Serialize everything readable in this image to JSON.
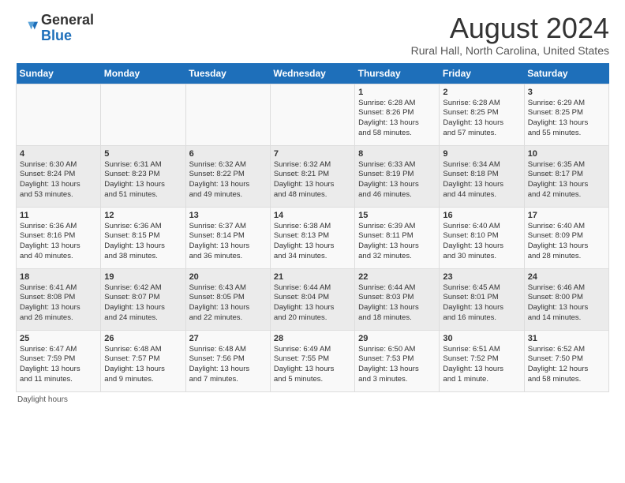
{
  "logo": {
    "general": "General",
    "blue": "Blue"
  },
  "title": "August 2024",
  "subtitle": "Rural Hall, North Carolina, United States",
  "footer": "Daylight hours",
  "headers": [
    "Sunday",
    "Monday",
    "Tuesday",
    "Wednesday",
    "Thursday",
    "Friday",
    "Saturday"
  ],
  "weeks": [
    [
      {
        "day": "",
        "info": ""
      },
      {
        "day": "",
        "info": ""
      },
      {
        "day": "",
        "info": ""
      },
      {
        "day": "",
        "info": ""
      },
      {
        "day": "1",
        "info": "Sunrise: 6:28 AM\nSunset: 8:26 PM\nDaylight: 13 hours\nand 58 minutes."
      },
      {
        "day": "2",
        "info": "Sunrise: 6:28 AM\nSunset: 8:25 PM\nDaylight: 13 hours\nand 57 minutes."
      },
      {
        "day": "3",
        "info": "Sunrise: 6:29 AM\nSunset: 8:25 PM\nDaylight: 13 hours\nand 55 minutes."
      }
    ],
    [
      {
        "day": "4",
        "info": "Sunrise: 6:30 AM\nSunset: 8:24 PM\nDaylight: 13 hours\nand 53 minutes."
      },
      {
        "day": "5",
        "info": "Sunrise: 6:31 AM\nSunset: 8:23 PM\nDaylight: 13 hours\nand 51 minutes."
      },
      {
        "day": "6",
        "info": "Sunrise: 6:32 AM\nSunset: 8:22 PM\nDaylight: 13 hours\nand 49 minutes."
      },
      {
        "day": "7",
        "info": "Sunrise: 6:32 AM\nSunset: 8:21 PM\nDaylight: 13 hours\nand 48 minutes."
      },
      {
        "day": "8",
        "info": "Sunrise: 6:33 AM\nSunset: 8:19 PM\nDaylight: 13 hours\nand 46 minutes."
      },
      {
        "day": "9",
        "info": "Sunrise: 6:34 AM\nSunset: 8:18 PM\nDaylight: 13 hours\nand 44 minutes."
      },
      {
        "day": "10",
        "info": "Sunrise: 6:35 AM\nSunset: 8:17 PM\nDaylight: 13 hours\nand 42 minutes."
      }
    ],
    [
      {
        "day": "11",
        "info": "Sunrise: 6:36 AM\nSunset: 8:16 PM\nDaylight: 13 hours\nand 40 minutes."
      },
      {
        "day": "12",
        "info": "Sunrise: 6:36 AM\nSunset: 8:15 PM\nDaylight: 13 hours\nand 38 minutes."
      },
      {
        "day": "13",
        "info": "Sunrise: 6:37 AM\nSunset: 8:14 PM\nDaylight: 13 hours\nand 36 minutes."
      },
      {
        "day": "14",
        "info": "Sunrise: 6:38 AM\nSunset: 8:13 PM\nDaylight: 13 hours\nand 34 minutes."
      },
      {
        "day": "15",
        "info": "Sunrise: 6:39 AM\nSunset: 8:11 PM\nDaylight: 13 hours\nand 32 minutes."
      },
      {
        "day": "16",
        "info": "Sunrise: 6:40 AM\nSunset: 8:10 PM\nDaylight: 13 hours\nand 30 minutes."
      },
      {
        "day": "17",
        "info": "Sunrise: 6:40 AM\nSunset: 8:09 PM\nDaylight: 13 hours\nand 28 minutes."
      }
    ],
    [
      {
        "day": "18",
        "info": "Sunrise: 6:41 AM\nSunset: 8:08 PM\nDaylight: 13 hours\nand 26 minutes."
      },
      {
        "day": "19",
        "info": "Sunrise: 6:42 AM\nSunset: 8:07 PM\nDaylight: 13 hours\nand 24 minutes."
      },
      {
        "day": "20",
        "info": "Sunrise: 6:43 AM\nSunset: 8:05 PM\nDaylight: 13 hours\nand 22 minutes."
      },
      {
        "day": "21",
        "info": "Sunrise: 6:44 AM\nSunset: 8:04 PM\nDaylight: 13 hours\nand 20 minutes."
      },
      {
        "day": "22",
        "info": "Sunrise: 6:44 AM\nSunset: 8:03 PM\nDaylight: 13 hours\nand 18 minutes."
      },
      {
        "day": "23",
        "info": "Sunrise: 6:45 AM\nSunset: 8:01 PM\nDaylight: 13 hours\nand 16 minutes."
      },
      {
        "day": "24",
        "info": "Sunrise: 6:46 AM\nSunset: 8:00 PM\nDaylight: 13 hours\nand 14 minutes."
      }
    ],
    [
      {
        "day": "25",
        "info": "Sunrise: 6:47 AM\nSunset: 7:59 PM\nDaylight: 13 hours\nand 11 minutes."
      },
      {
        "day": "26",
        "info": "Sunrise: 6:48 AM\nSunset: 7:57 PM\nDaylight: 13 hours\nand 9 minutes."
      },
      {
        "day": "27",
        "info": "Sunrise: 6:48 AM\nSunset: 7:56 PM\nDaylight: 13 hours\nand 7 minutes."
      },
      {
        "day": "28",
        "info": "Sunrise: 6:49 AM\nSunset: 7:55 PM\nDaylight: 13 hours\nand 5 minutes."
      },
      {
        "day": "29",
        "info": "Sunrise: 6:50 AM\nSunset: 7:53 PM\nDaylight: 13 hours\nand 3 minutes."
      },
      {
        "day": "30",
        "info": "Sunrise: 6:51 AM\nSunset: 7:52 PM\nDaylight: 13 hours\nand 1 minute."
      },
      {
        "day": "31",
        "info": "Sunrise: 6:52 AM\nSunset: 7:50 PM\nDaylight: 12 hours\nand 58 minutes."
      }
    ]
  ]
}
